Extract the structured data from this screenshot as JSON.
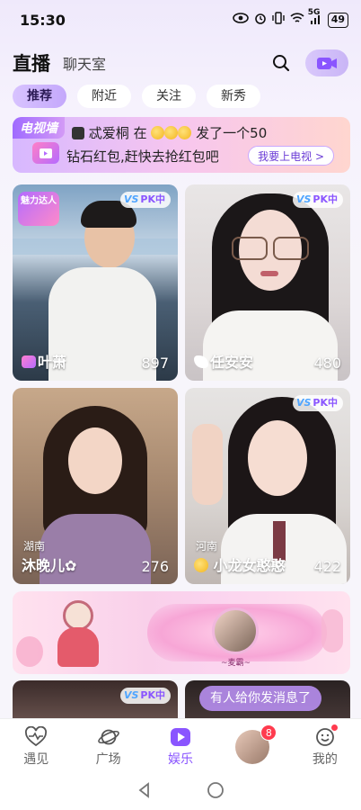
{
  "status_bar": {
    "time": "15:30",
    "battery": "49",
    "network": "5G"
  },
  "header": {
    "tab_live": "直播",
    "tab_chat": "聊天室"
  },
  "subtabs": [
    "推荐",
    "附近",
    "关注",
    "新秀"
  ],
  "banner": {
    "tag": "电视墙",
    "line1_prefix": "忒爱桐",
    "line1_mid": "在",
    "line1_suffix": "发了一个50",
    "line2": "钻石红包,赶快去抢红包吧",
    "button": "我要上电视 >"
  },
  "cards": [
    {
      "name": "叶萧",
      "count": "897",
      "badge": "PK中",
      "location": "",
      "tag": "魅力达人"
    },
    {
      "name": "任安安",
      "count": "480",
      "badge": "PK中",
      "location": ""
    },
    {
      "name": "沐晚儿✿",
      "count": "276",
      "badge": "",
      "location": "湖南"
    },
    {
      "name": "小龙女憨憨",
      "count": "422",
      "badge": "PK中",
      "location": "河南"
    }
  ],
  "promo": {
    "label": "~麦霸~"
  },
  "partial_cards": [
    {
      "badge": "PK中"
    }
  ],
  "toast": "有人给你发消息了",
  "bottom_nav": [
    {
      "label": "遇见",
      "icon": "heartbeat-icon"
    },
    {
      "label": "广场",
      "icon": "planet-icon"
    },
    {
      "label": "娱乐",
      "icon": "play-icon"
    },
    {
      "label": "",
      "icon": "avatar",
      "badge": "8"
    },
    {
      "label": "我的",
      "icon": "face-icon"
    }
  ],
  "colors": {
    "accent": "#8a55ff",
    "badge": "#ff3b4e"
  }
}
